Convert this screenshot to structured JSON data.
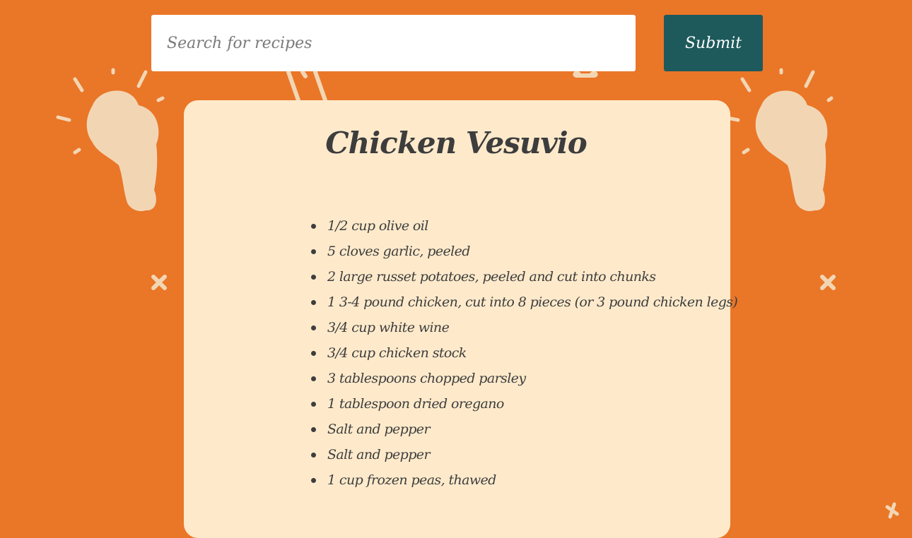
{
  "search": {
    "placeholder": "Search for recipes",
    "submit_label": "Submit"
  },
  "recipe": {
    "title": "Chicken Vesuvio",
    "ingredients": [
      "1/2 cup olive oil",
      "5 cloves garlic, peeled",
      "2 large russet potatoes, peeled and cut into chunks",
      "1 3-4 pound chicken, cut into 8 pieces (or 3 pound chicken legs)",
      "3/4 cup white wine",
      "3/4 cup chicken stock",
      "3 tablespoons chopped parsley",
      "1 tablespoon dried oregano",
      "Salt and pepper",
      "Salt and pepper",
      "1 cup frozen peas, thawed"
    ]
  },
  "colors": {
    "background": "#ea7628",
    "card": "#feeacb",
    "button": "#1e5a5c",
    "text": "#3d3d3d",
    "decoration": "#f2d6b4"
  },
  "decorations": {
    "icons": [
      "chicken-drumstick-icon",
      "chicken-drumstick-icon",
      "cross-icon",
      "cross-icon",
      "cross-icon"
    ]
  }
}
